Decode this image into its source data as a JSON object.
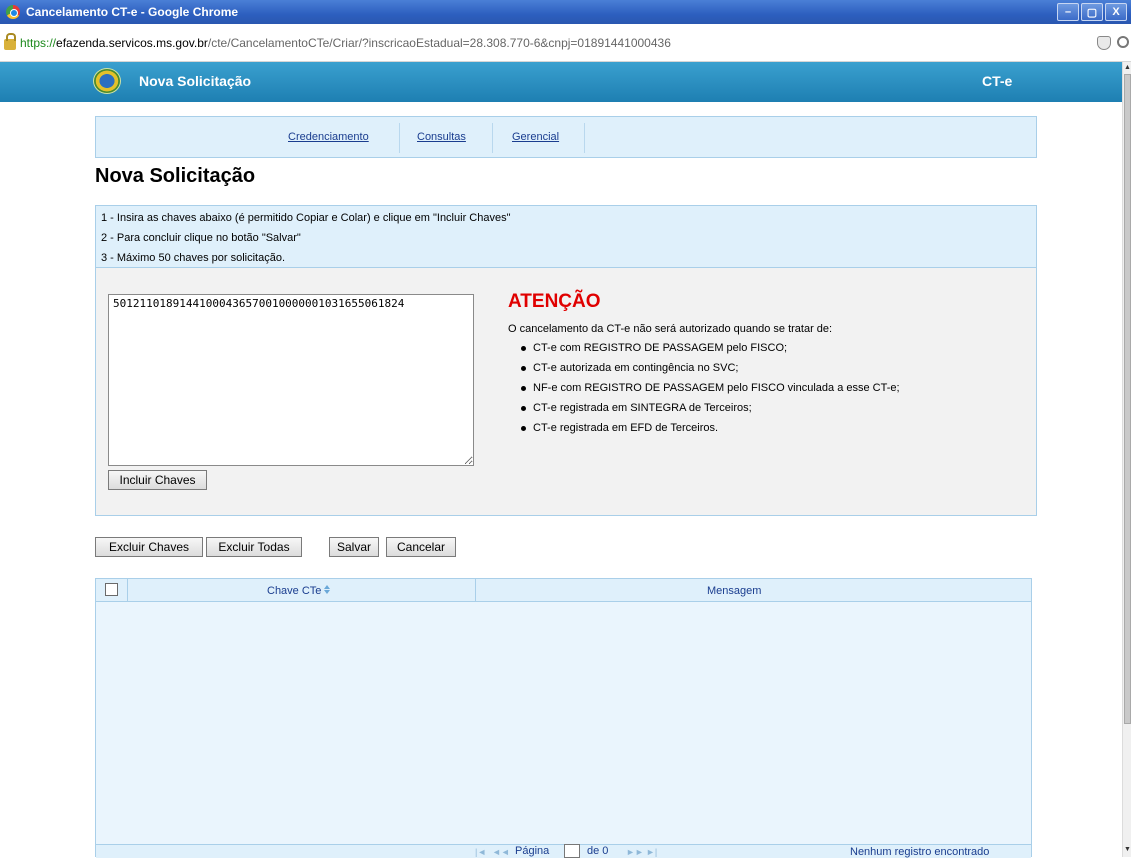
{
  "window": {
    "title": "Cancelamento CT-e - Google Chrome",
    "controls": {
      "minimize": "–",
      "maximize": "▢",
      "close": "X"
    }
  },
  "address": {
    "scheme": "https://",
    "host": "efazenda.servicos.ms.gov.br",
    "path": "/cte/CancelamentoCTe/Criar/?inscricaoEstadual=28.308.770-6&cnpj=01891441000436"
  },
  "header": {
    "title": "Nova Solicitação",
    "right_label": "CT-e"
  },
  "nav": {
    "items": [
      "Credenciamento",
      "Consultas",
      "Gerencial"
    ]
  },
  "page": {
    "title": "Nova Solicitação"
  },
  "instructions": [
    "1 - Insira as chaves abaixo (é permitido Copiar e Colar) e clique em \"Incluir Chaves\"",
    "2 - Para concluir clique no botão \"Salvar\"",
    "3 - Máximo 50 chaves por solicitação."
  ],
  "form": {
    "chaves_value": "50121101891441000436570010000001031655061824",
    "incluir_label": "Incluir Chaves"
  },
  "attention": {
    "title": "ATENÇÃO",
    "intro": "O cancelamento da CT-e não será autorizado quando se tratar de:",
    "items": [
      "CT-e com REGISTRO DE PASSAGEM pelo FISCO;",
      "CT-e autorizada em contingência no SVC;",
      "NF-e com REGISTRO DE PASSAGEM pelo FISCO vinculada a esse CT-e;",
      "CT-e registrada em SINTEGRA de Terceiros;",
      "CT-e registrada em EFD de Terceiros."
    ]
  },
  "actions": {
    "excluir_chaves": "Excluir Chaves",
    "excluir_todas": "Excluir Todas",
    "salvar": "Salvar",
    "cancelar": "Cancelar"
  },
  "grid": {
    "columns": [
      "Chave CTe",
      "Mensagem"
    ],
    "rows": [],
    "pager": {
      "page_label": "Página",
      "page_value": "",
      "of_label": "de 0",
      "records_text": "Nenhum registro encontrado"
    }
  }
}
